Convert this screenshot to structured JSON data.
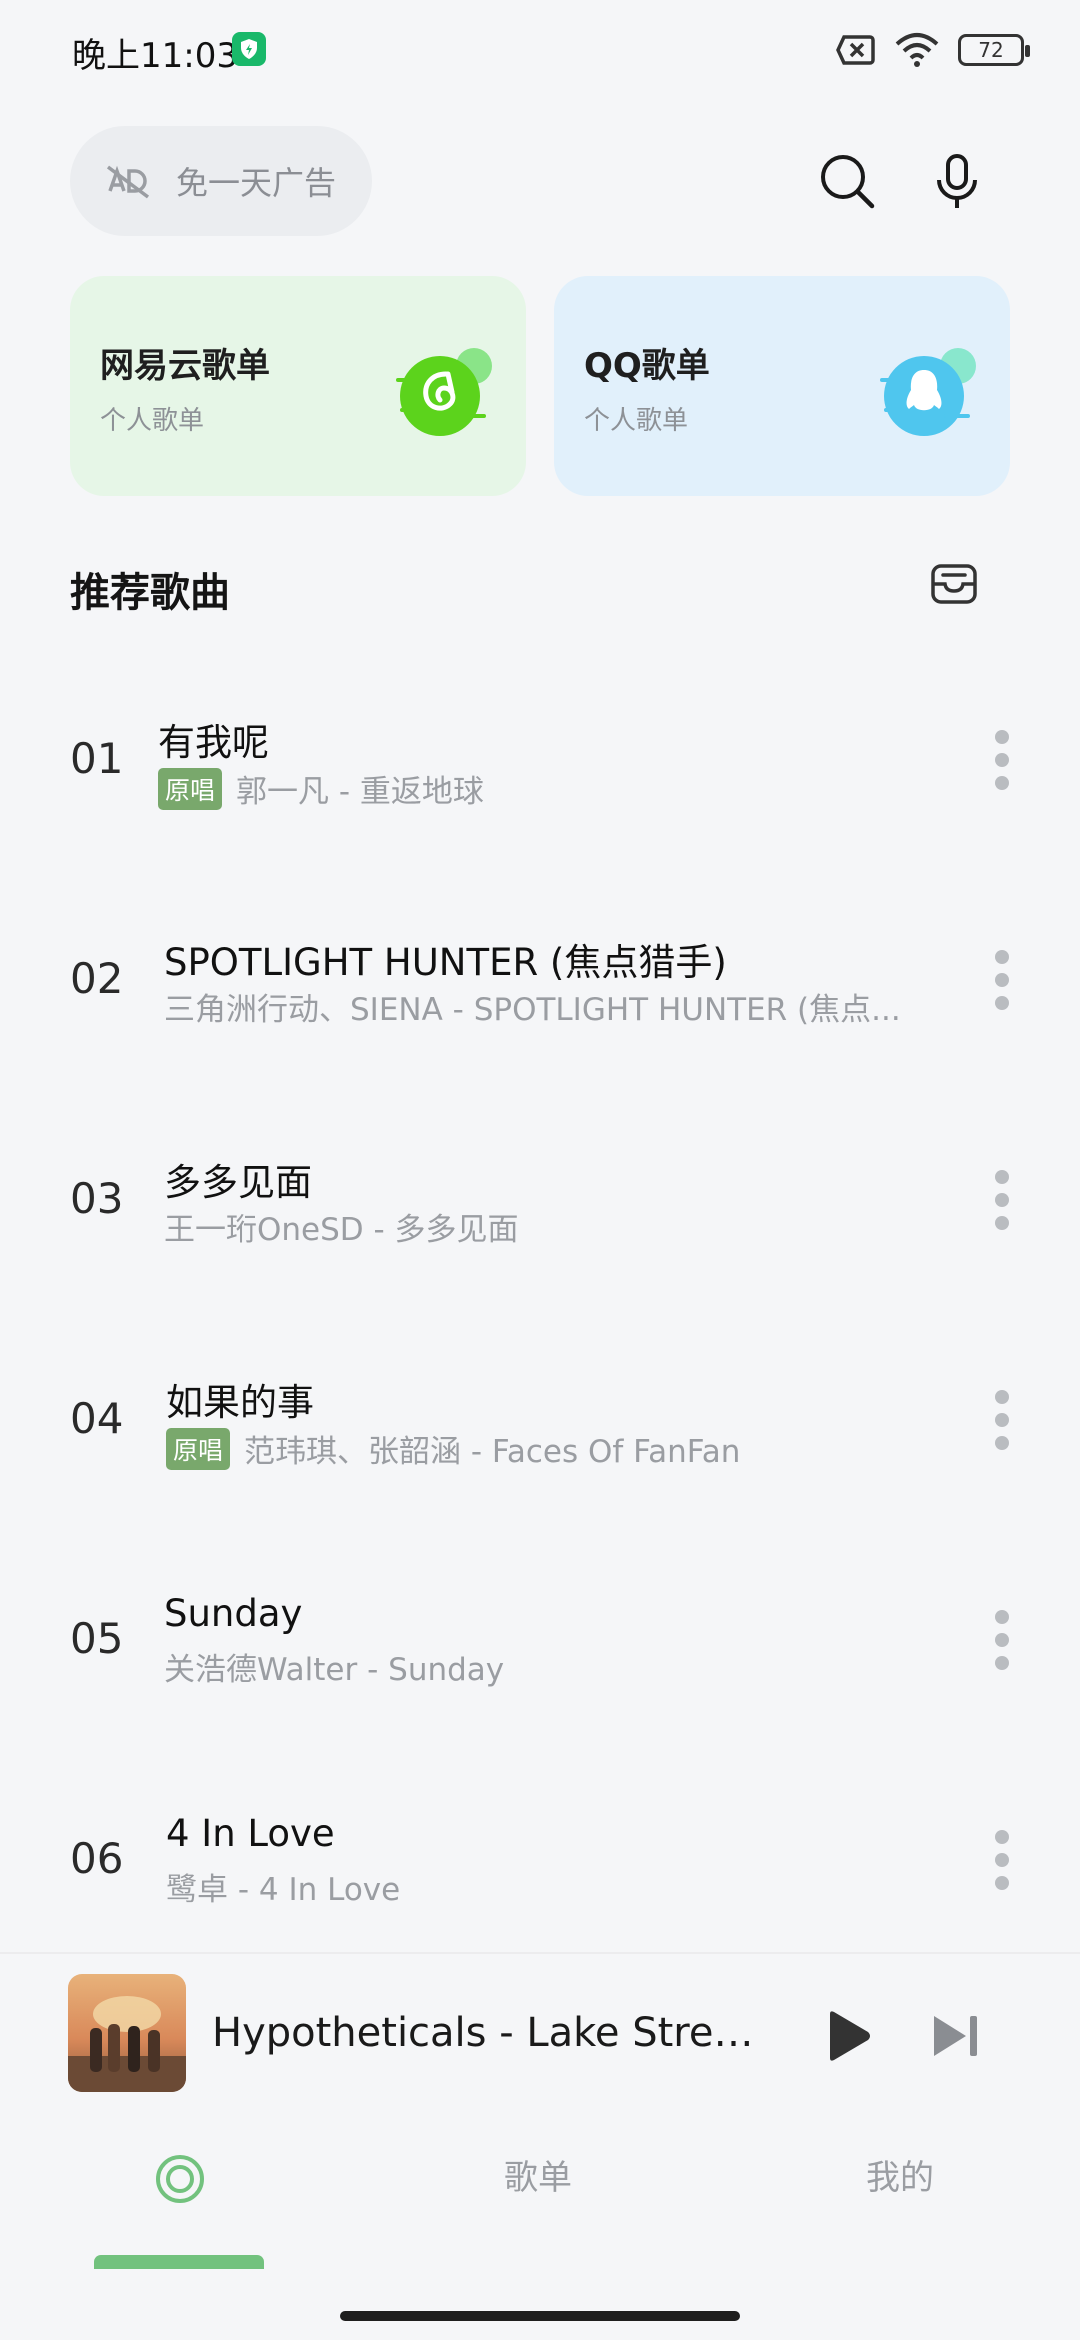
{
  "status_bar": {
    "time": "晚上11:03",
    "battery": "72"
  },
  "search": {
    "ad_free_label": "免一天广告"
  },
  "playlist_cards": [
    {
      "title": "网易云歌单",
      "subtitle": "个人歌单",
      "icon": "netease-music-icon",
      "accent": "#5cd31c"
    },
    {
      "title": "QQ歌单",
      "subtitle": "个人歌单",
      "icon": "qq-penguin-icon",
      "accent": "#4fc6ee"
    }
  ],
  "section": {
    "title": "推荐歌曲"
  },
  "songs": [
    {
      "num": "01",
      "title": "有我呢",
      "badge": "原唱",
      "subtitle": "郭一凡 - 重返地球"
    },
    {
      "num": "02",
      "title": "SPOTLIGHT HUNTER (焦点猎手)",
      "badge": "",
      "subtitle": "三角洲行动、SIENA - SPOTLIGHT HUNTER (焦点..."
    },
    {
      "num": "03",
      "title": "多多见面",
      "badge": "",
      "subtitle": "王一珩OneSD - 多多见面"
    },
    {
      "num": "04",
      "title": "如果的事",
      "badge": "原唱",
      "subtitle": "范玮琪、张韶涵 - Faces Of FanFan"
    },
    {
      "num": "05",
      "title": "Sunday",
      "badge": "",
      "subtitle": "关浩德Walter - Sunday"
    },
    {
      "num": "06",
      "title": "4 In Love",
      "badge": "",
      "subtitle": "鹭卓 - 4 In Love"
    }
  ],
  "player": {
    "now_playing": "Hypotheticals - Lake Stree..."
  },
  "bottom_nav": {
    "tabs": [
      "歌单",
      "我的"
    ]
  },
  "colors": {
    "background": "#f5f6f8",
    "badge": "#79a86c",
    "accent_green": "#72c27e"
  }
}
